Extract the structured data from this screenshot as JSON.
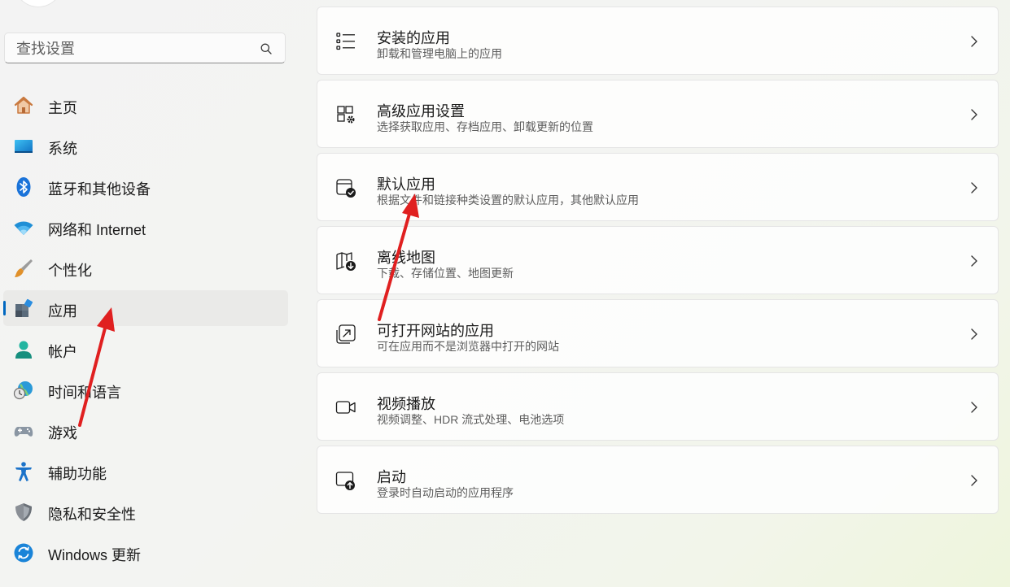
{
  "search": {
    "placeholder": "查找设置"
  },
  "sidebar": {
    "items": [
      {
        "label": "主页",
        "icon": "home-icon"
      },
      {
        "label": "系统",
        "icon": "system-icon"
      },
      {
        "label": "蓝牙和其他设备",
        "icon": "bluetooth-icon"
      },
      {
        "label": "网络和 Internet",
        "icon": "wifi-icon"
      },
      {
        "label": "个性化",
        "icon": "brush-icon"
      },
      {
        "label": "应用",
        "icon": "apps-icon",
        "selected": true
      },
      {
        "label": "帐户",
        "icon": "account-icon"
      },
      {
        "label": "时间和语言",
        "icon": "time-language-icon"
      },
      {
        "label": "游戏",
        "icon": "gamepad-icon"
      },
      {
        "label": "辅助功能",
        "icon": "accessibility-icon"
      },
      {
        "label": "隐私和安全性",
        "icon": "shield-icon"
      },
      {
        "label": "Windows 更新",
        "icon": "update-icon"
      }
    ]
  },
  "cards": [
    {
      "title": "安装的应用",
      "subtitle": "卸载和管理电脑上的应用",
      "icon": "list-icon"
    },
    {
      "title": "高级应用设置",
      "subtitle": "选择获取应用、存档应用、卸载更新的位置",
      "icon": "advanced-app-settings-icon"
    },
    {
      "title": "默认应用",
      "subtitle": "根据文件和链接种类设置的默认应用，其他默认应用",
      "icon": "default-apps-icon"
    },
    {
      "title": "离线地图",
      "subtitle": "下载、存储位置、地图更新",
      "icon": "offline-map-icon"
    },
    {
      "title": "可打开网站的应用",
      "subtitle": "可在应用而不是浏览器中打开的网站",
      "icon": "open-website-icon"
    },
    {
      "title": "视频播放",
      "subtitle": "视频调整、HDR 流式处理、电池选项",
      "icon": "video-camera-icon"
    },
    {
      "title": "启动",
      "subtitle": "登录时自动启动的应用程序",
      "icon": "startup-icon"
    }
  ],
  "colors": {
    "accent": "#0067c0",
    "annotation_arrow": "#e02020"
  }
}
